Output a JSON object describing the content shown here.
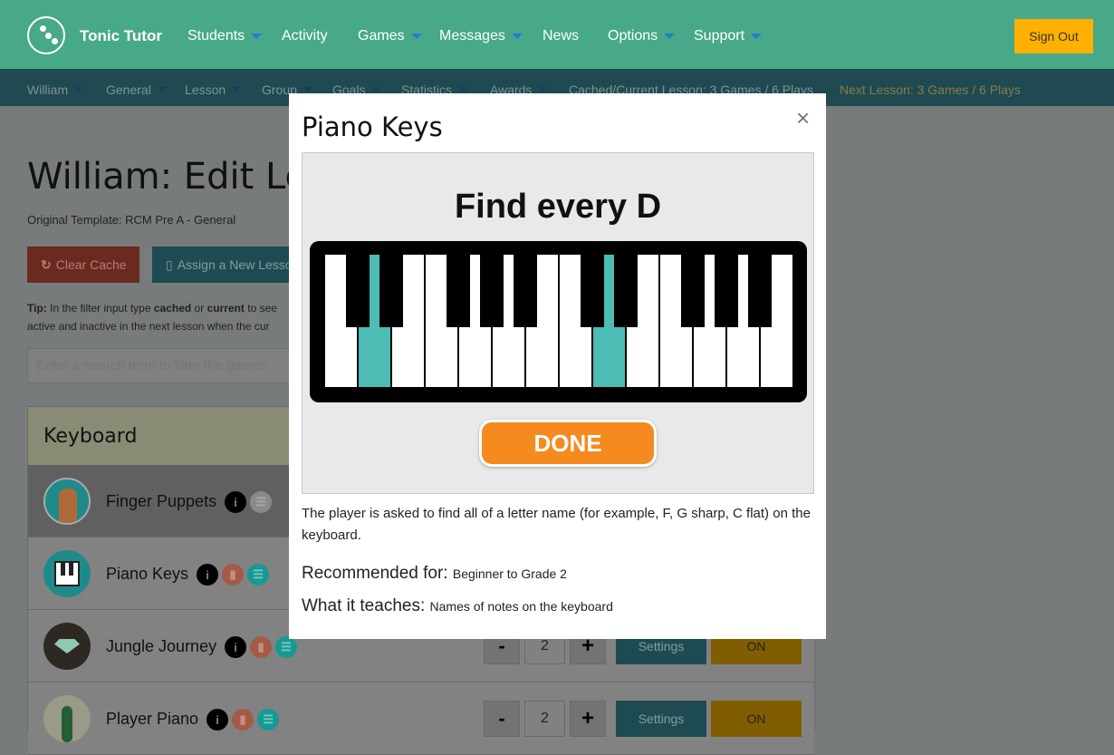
{
  "topnav": {
    "brand": "Tonic Tutor",
    "items": [
      {
        "label": "Students",
        "caret": true
      },
      {
        "label": "Activity",
        "caret": false
      },
      {
        "label": "Games",
        "caret": true
      },
      {
        "label": "Messages",
        "caret": true
      },
      {
        "label": "News",
        "caret": false
      },
      {
        "label": "Options",
        "caret": true
      },
      {
        "label": "Support",
        "caret": true
      }
    ],
    "sign_out": "Sign Out"
  },
  "subnav": {
    "items": [
      "William",
      "General",
      "Lesson",
      "Group",
      "Goals",
      "Statistics",
      "Awards"
    ],
    "cached": "Cached/Current Lesson: 3 Games / 6 Plays",
    "next": "Next Lesson: 3 Games / 6 Plays"
  },
  "page": {
    "title": "William: Edit Lesson",
    "template": "Original Template: RCM Pre A - General",
    "clear_cache": "Clear Cache",
    "assign": "Assign a New Lesson",
    "tip": {
      "label": "Tip:",
      "t1": " In the filter input type ",
      "w1": "cached",
      "t2": " or ",
      "w2": "current",
      "t3": " to see",
      "line2": "active and inactive in the next lesson when the cur"
    },
    "search_placeholder": "Enter a search term to filter the games"
  },
  "card": {
    "title": "Keyboard",
    "games": [
      {
        "name": "Finger Puppets",
        "selected": true,
        "stats": false,
        "count": "",
        "settings": "",
        "state": ""
      },
      {
        "name": "Piano Keys",
        "selected": false,
        "stats": true,
        "count": "",
        "settings": "",
        "state": ""
      },
      {
        "name": "Jungle Journey",
        "selected": false,
        "stats": true,
        "count": "2",
        "settings": "Settings",
        "state": "ON"
      },
      {
        "name": "Player Piano",
        "selected": false,
        "stats": true,
        "count": "2",
        "settings": "Settings",
        "state": "ON"
      }
    ],
    "minus": "-",
    "plus": "+"
  },
  "modal": {
    "title": "Piano Keys",
    "close": "×",
    "image_title": "Find every D",
    "done": "DONE",
    "highlight_note": "D",
    "description": "The player is asked to find all of a letter name (for example, F, G sharp, C flat) on the keyboard.",
    "recommended_label": "Recommended for:",
    "recommended": "Beginner to Grade 2",
    "teaches_label": "What it teaches:",
    "teaches": "Names of notes on the keyboard"
  },
  "colors": {
    "brand": "#47a987",
    "sign_out": "#ffb000",
    "highlight_key": "#4dbcb5",
    "done": "#f58a1f"
  }
}
